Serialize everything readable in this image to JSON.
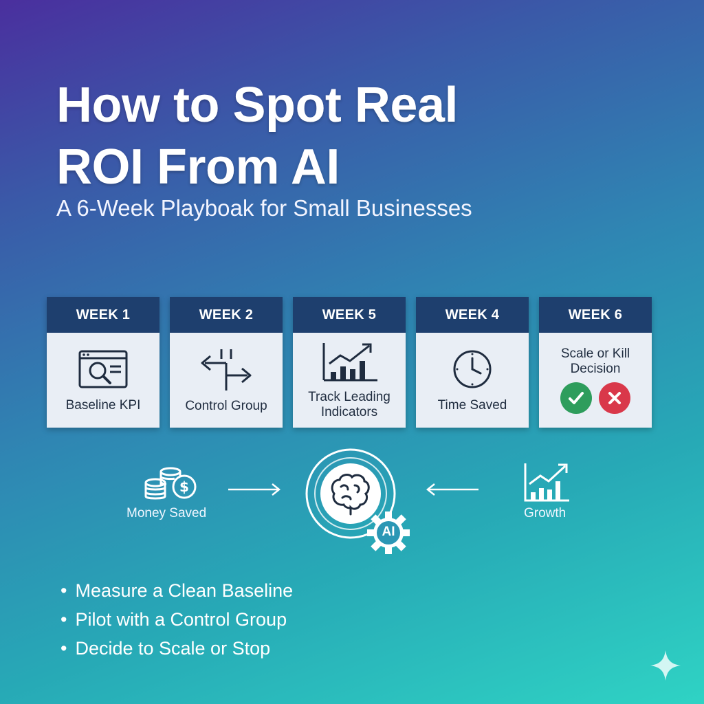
{
  "title_line1": "How to Spot Real",
  "title_line2": "ROI From AI",
  "subtitle": "A 6-Week Playboak for Small Businesses",
  "weeks": [
    {
      "header": "WEEK 1",
      "label": "Baseline KPI",
      "icon": "search-document-icon"
    },
    {
      "header": "WEEK 2",
      "label": "Control Group",
      "icon": "split-arrows-icon"
    },
    {
      "header": "WEEK 5",
      "label": "Track Leading Indicators",
      "icon": "bar-chart-growth-icon"
    },
    {
      "header": "WEEK 4",
      "label": "Time Saved",
      "icon": "clock-icon"
    },
    {
      "header": "WEEK 6",
      "label": "Scale or Kill Decision",
      "icon": "check-and-x-icons"
    }
  ],
  "flow": {
    "left_label": "Money Saved",
    "right_label": "Growth",
    "hub_badge": "AI"
  },
  "bullets": [
    "Measure a Clean Baseline",
    "Pilot with a Control Group",
    "Decide to Scale or Stop"
  ],
  "colors": {
    "card_header": "#1e3f6e",
    "card_body": "#e9eef5",
    "check": "#2e9d5c",
    "cross": "#d9384a"
  }
}
